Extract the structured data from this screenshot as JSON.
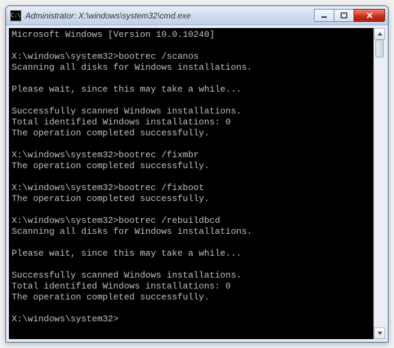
{
  "window": {
    "title": "Administrator: X:\\windows\\system32\\cmd.exe",
    "icon_label": "cmd-icon"
  },
  "controls": {
    "minimize": "Minimize",
    "maximize": "Maximize",
    "close": "Close"
  },
  "console": {
    "lines": [
      "Microsoft Windows [Version 10.0.10240]",
      "",
      "X:\\windows\\system32>bootrec /scanos",
      "Scanning all disks for Windows installations.",
      "",
      "Please wait, since this may take a while...",
      "",
      "Successfully scanned Windows installations.",
      "Total identified Windows installations: 0",
      "The operation completed successfully.",
      "",
      "X:\\windows\\system32>bootrec /fixmbr",
      "The operation completed successfully.",
      "",
      "X:\\windows\\system32>bootrec /fixboot",
      "The operation completed successfully.",
      "",
      "X:\\windows\\system32>bootrec /rebuildbcd",
      "Scanning all disks for Windows installations.",
      "",
      "Please wait, since this may take a while...",
      "",
      "Successfully scanned Windows installations.",
      "Total identified Windows installations: 0",
      "The operation completed successfully.",
      "",
      "X:\\windows\\system32>"
    ]
  }
}
